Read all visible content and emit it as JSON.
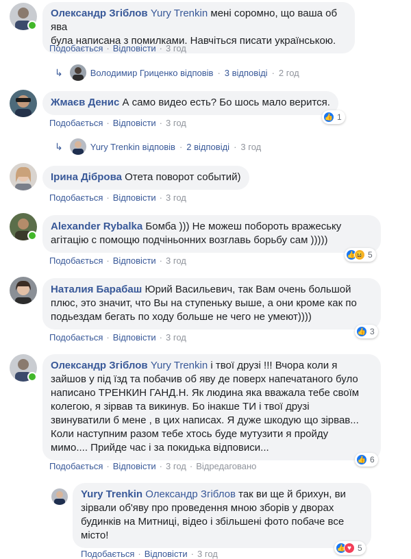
{
  "actions": {
    "like": "Подобається",
    "reply": "Відповісти",
    "edited": "Відредаговано",
    "time": "3 год"
  },
  "comments": [
    {
      "author": "Олександр Згіблов",
      "mention": "Yury Trenkin",
      "lines": [
        "мені соромно, що ваша об ява",
        "була написана з помилками. Навчіться писати українською."
      ],
      "time": "3 год",
      "online": true,
      "reply_summary": {
        "author": "Володимир Гриценко відповів",
        "count": "3 відповіді",
        "time": "2 год"
      }
    },
    {
      "author": "Жмаєв Денис",
      "text": "А само видео есть? Бо шось мало верится.",
      "time": "3 год",
      "reactions": "1",
      "reply_summary": {
        "author": "Yury Trenkin відповів",
        "count": "2 відповіді",
        "time": "3 год"
      }
    },
    {
      "author": "Ірина Діброва",
      "text": "Отета поворот событий)",
      "time": "3 год"
    },
    {
      "author": "Alexander Rybalka",
      "lines": [
        "Бомба ))) Не можеш побороть вражеську",
        "агітацію с помощю подчіньонних возглавь борьбу сам )))))"
      ],
      "time": "3 год",
      "online": true,
      "reactions": "5"
    },
    {
      "author": "Наталия Барабаш",
      "lines": [
        "Юрий Васильевич, так Вам очень большой",
        "плюс, это значит, что Вы на ступеньку выше, а они кроме как по",
        "подьездам бегать по ходу больше не чего не умеют))))"
      ],
      "time": "3 год",
      "reactions": "3"
    },
    {
      "author": "Олександр Згіблов",
      "mention": "Yury Trenkin",
      "lines": [
        "і твої друзі !!! Вчора коли я",
        "зайшов у під їзд та побачив об яву де поверх напечатаного було",
        "написано ТРЕНКИН ГАНД.Н. Як людина яка вважала тебе своїм",
        "колегою, я зірвав та викинув. Бо інакше ТИ і твої друзі",
        "звинуватили б мене , в цих написах. Я дуже шкодую що зірвав...",
        "Коли наступним разом тебе хтось буде мутузити я пройду",
        "мимо.... Прийде час і за покидька відповиси..."
      ],
      "time": "3 год",
      "online": true,
      "reactions": "6"
    },
    {
      "author": "Yury Trenkin",
      "mention": "Олександр Згіблов",
      "lines": [
        "так ви ще й брихун, ви",
        "зірвали об'яву про проведення мною зборів у дворах",
        "будинків на Митниці, відео і збільшені фото побаче все",
        "місто!"
      ],
      "time": "3 год",
      "reactions": "5"
    }
  ],
  "colors": {
    "link": "#385898",
    "bubble": "#f2f3f5",
    "meta": "#90949c",
    "like": "#1877f2",
    "love": "#f33e58",
    "haha": "#f7b125",
    "online": "#42b72a"
  }
}
